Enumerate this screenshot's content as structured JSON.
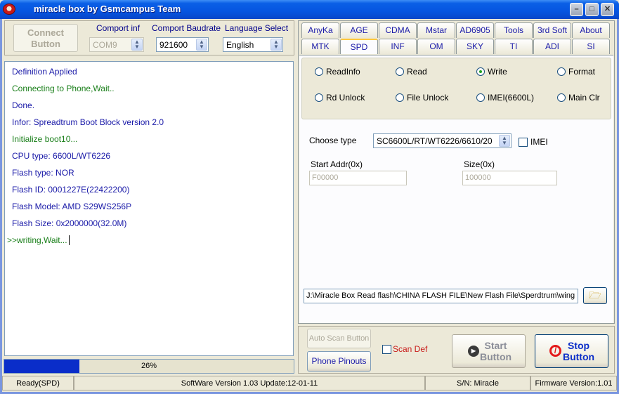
{
  "window": {
    "title": "miracle box by Gsmcampus Team"
  },
  "connect": {
    "button": "Connect\nButton",
    "button_l1": "Connect",
    "button_l2": "Button",
    "comport_label": "Comport inf",
    "comport_value": "COM9",
    "baud_label": "Comport Baudrate",
    "baud_value": "921600",
    "lang_label": "Language Select",
    "lang_value": "English"
  },
  "log": {
    "lines": [
      {
        "text": "Definition Applied",
        "color": "blue"
      },
      {
        "text": "Connecting to Phone,Wait..",
        "color": "green"
      },
      {
        "text": "Done.",
        "color": "blue"
      },
      {
        "text": "Infor: Spreadtrum Boot Block version 2.0",
        "color": "blue"
      },
      {
        "text": "Initialize boot10...",
        "color": "green"
      },
      {
        "text": "CPU   type: 6600L/WT6226",
        "color": "blue"
      },
      {
        "text": "Flash  type: NOR",
        "color": "blue"
      },
      {
        "text": "Flash    ID: 0001227E(22422200)",
        "color": "blue"
      },
      {
        "text": "Flash Model: AMD S29WS256P",
        "color": "blue"
      },
      {
        "text": "Flash  Size: 0x2000000(32.0M)",
        "color": "blue"
      },
      {
        "text": ">>writing,Wait...",
        "color": "green"
      }
    ]
  },
  "progress": {
    "percent_text": "26%",
    "value": 0.26
  },
  "tabs": {
    "row1": [
      "AnyKa",
      "AGE",
      "CDMA",
      "Mstar",
      "AD6905",
      "Tools",
      "3rd Soft",
      "About"
    ],
    "row2": [
      "MTK",
      "SPD",
      "INF",
      "OM",
      "SKY",
      "TI",
      "ADI",
      "SI"
    ],
    "active": "SPD"
  },
  "spd": {
    "radios": [
      {
        "label": "ReadInfo",
        "on": false
      },
      {
        "label": "Read",
        "on": false
      },
      {
        "label": "Write",
        "on": true
      },
      {
        "label": "Format",
        "on": false
      },
      {
        "label": "Rd Unlock",
        "on": false
      },
      {
        "label": "File Unlock",
        "on": false
      },
      {
        "label": "IMEI(6600L)",
        "on": false
      },
      {
        "label": "Main Clr",
        "on": false
      }
    ],
    "choose_label": "Choose  type",
    "choose_value": "SC6600L/RT/WT6226/6610/20",
    "imei_label": "IMEI",
    "start_label": "Start Addr(0x)",
    "start_value": "F00000",
    "size_label": "Size(0x)",
    "size_value": "100000",
    "file_path": "J:\\Miracle Box Read flash\\CHINA FLASH FILE\\New Flash File\\Sperdtrum\\wing"
  },
  "bottom": {
    "auto_scan": "Auto Scan Button",
    "phone_pinouts": "Phone Pinouts",
    "scan_def": "Scan Def",
    "start_l1": "Start",
    "start_l2": "Button",
    "stop_l1": "Stop",
    "stop_l2": "Button"
  },
  "status": {
    "state": "Ready(SPD)",
    "version": "SoftWare Version 1.03  Update:12-01-11",
    "sn": "S/N: Miracle",
    "firmware": "Firmware Version:1.01"
  }
}
